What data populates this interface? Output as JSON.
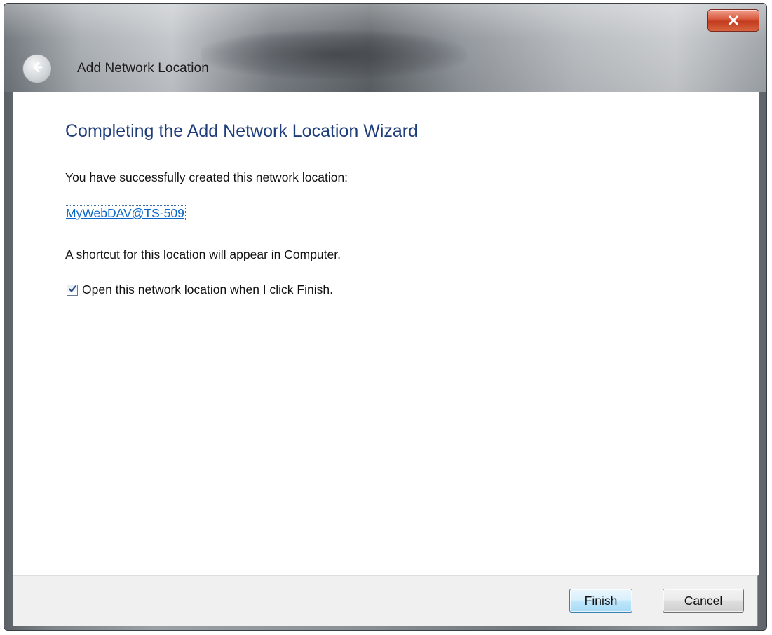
{
  "window": {
    "title": "Add Network Location"
  },
  "wizard": {
    "heading": "Completing the Add Network Location Wizard",
    "success_text": "You have successfully created this network location:",
    "location_link": "MyWebDAV@TS-509",
    "shortcut_text": "A shortcut for this location will appear in Computer.",
    "open_checkbox": {
      "label": "Open this network location when I click Finish.",
      "checked": true
    }
  },
  "buttons": {
    "finish": "Finish",
    "cancel": "Cancel"
  },
  "icons": {
    "close": "close-icon",
    "back": "back-arrow-icon",
    "check": "checkmark-icon"
  },
  "colors": {
    "heading": "#1e3d7b",
    "link": "#0b66c7",
    "close_button": "#c23b1f"
  }
}
